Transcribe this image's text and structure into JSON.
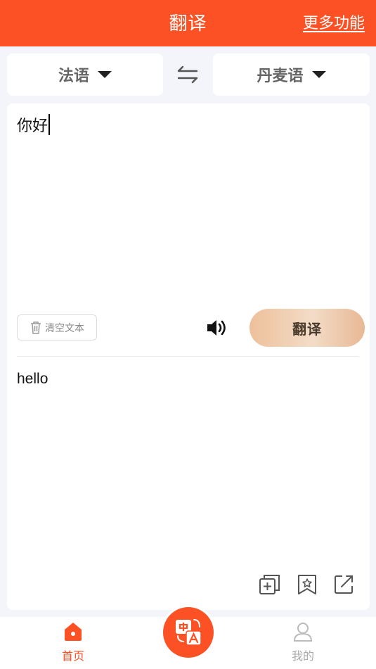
{
  "header": {
    "title": "翻译",
    "more_label": "更多功能"
  },
  "languages": {
    "source": "法语",
    "target": "丹麦语"
  },
  "input": {
    "text": "你好"
  },
  "controls": {
    "clear_label": "清空文本",
    "translate_label": "翻译"
  },
  "output": {
    "text": "hello"
  },
  "tabbar": {
    "home_label": "首页",
    "mine_label": "我的"
  },
  "icons": [
    "swap-icon",
    "trash-icon",
    "speaker-icon",
    "copy-icon",
    "bookmark-icon",
    "share-icon",
    "home-icon",
    "translate-icon",
    "user-icon"
  ],
  "colors": {
    "brand": "#fc5124",
    "button_gradient_start": "#eec09b",
    "button_gradient_end": "#e8b894"
  }
}
